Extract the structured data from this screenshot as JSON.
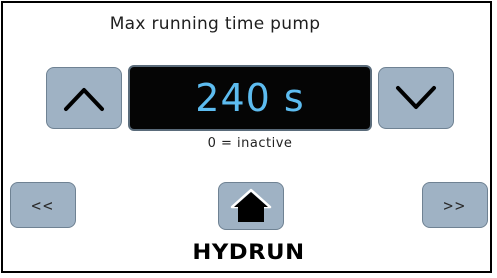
{
  "screen": {
    "title": "Max running time pump",
    "value_display": "240 s",
    "hint": "0 = inactive"
  },
  "navigation": {
    "prev_label": "<<",
    "next_label": ">>"
  },
  "brand": {
    "logo_text": "HYDRUN"
  },
  "icons": {
    "increase": "chevron-up-icon",
    "decrease": "chevron-down-icon",
    "home": "home-icon"
  },
  "colors": {
    "button": "#9fb2c4",
    "display_background": "#050505",
    "display_text": "#5dbcf0"
  }
}
